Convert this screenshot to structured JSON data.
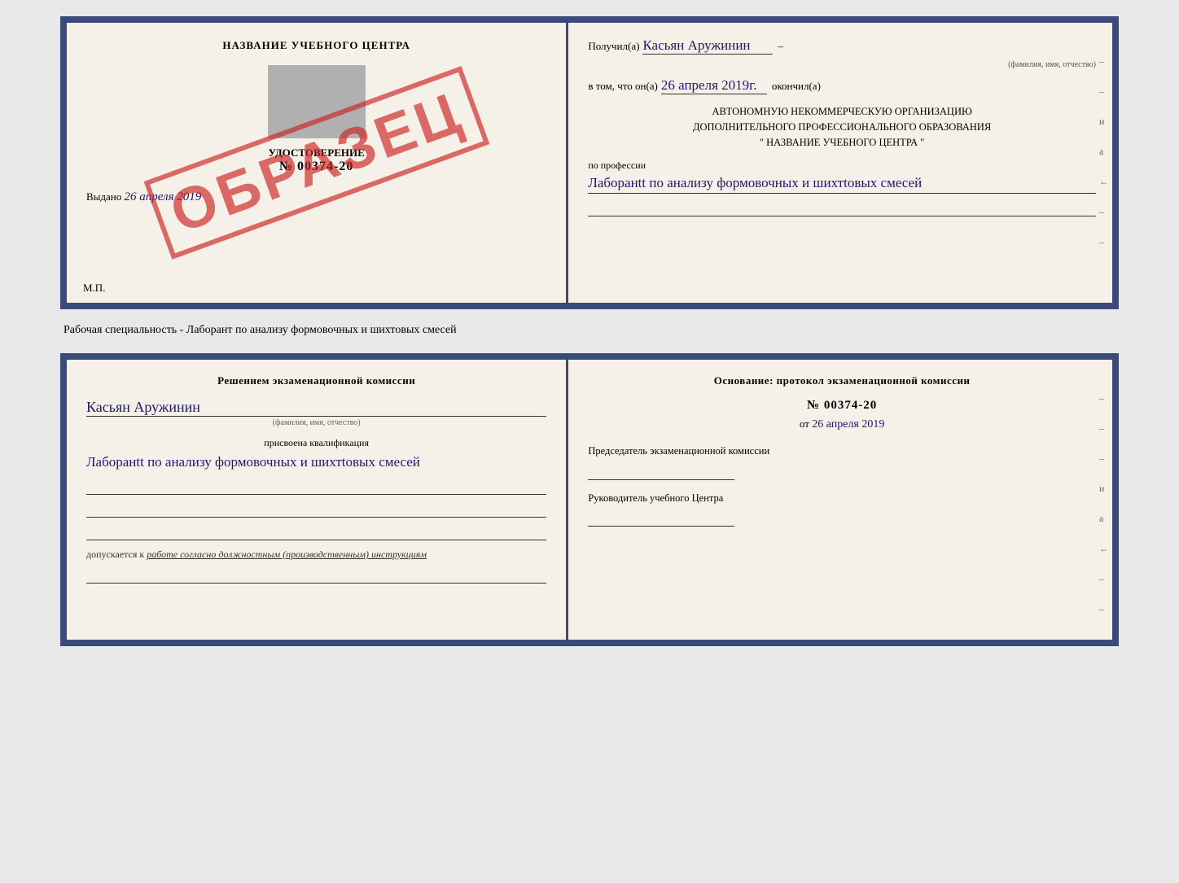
{
  "top_cert": {
    "left": {
      "title": "НАЗВАНИЕ УЧЕБНОГО ЦЕНТРА",
      "cert_label": "УДОСТОВЕРЕНИЕ",
      "cert_number_prefix": "№",
      "cert_number": "00374-20",
      "issued_prefix": "Выдано",
      "issued_date": "26 апреля 2019",
      "mp": "М.П.",
      "stamp": "ОБРАЗЕЦ"
    },
    "right": {
      "received_label": "Получил(а)",
      "received_name": "Касьян Аружинин",
      "received_name_sub": "(фамилия, имя, отчество)",
      "in_that_label": "в том, что он(а)",
      "date_value": "26 апреля 2019г.",
      "completed_label": "окончил(а)",
      "org_line1": "АВТОНОМНУЮ НЕКОММЕРЧЕСКУЮ ОРГАНИЗАЦИЮ",
      "org_line2": "ДОПОЛНИТЕЛЬНОГО ПРОФЕССИОНАЛЬНОГО ОБРАЗОВАНИЯ",
      "org_name_quotes": "\"  НАЗВАНИЕ УЧЕБНОГО ЦЕНТРА  \"",
      "profession_label": "по профессии",
      "profession_value": "Лаборанtt по анализу формовочных и шихтtовых смесей",
      "dashes": [
        "-",
        "-",
        "и",
        "а",
        "←",
        "-",
        "-"
      ]
    }
  },
  "specialty_label": "Рабочая специальность - Лаборант по анализу формовочных и шихтовых смесей",
  "bottom_cert": {
    "left": {
      "decision_title": "Решением экзаменационной комиссии",
      "name_value": "Касьян Аружинин",
      "name_sub": "(фамилия, имя, отчество)",
      "qualification_label": "присвоена квалификация",
      "qualification_value": "Лаборанtt по анализу формовочных и шихтtовых смесей",
      "допускается_prefix": "допускается к",
      "допускается_value": "работе согласно должностным (производственным) инструкциям"
    },
    "right": {
      "basis_title": "Основание: протокол экзаменационной комиссии",
      "protocol_num_prefix": "№",
      "protocol_num": "00374-20",
      "date_prefix": "от",
      "date_value": "26 апреля 2019",
      "chairman_label": "Председатель экзаменационной комиссии",
      "rukovoditel_label": "Руководитель учебного Центра",
      "dashes": [
        "-",
        "-",
        "-",
        "и",
        "а",
        "←",
        "-",
        "-"
      ]
    }
  }
}
